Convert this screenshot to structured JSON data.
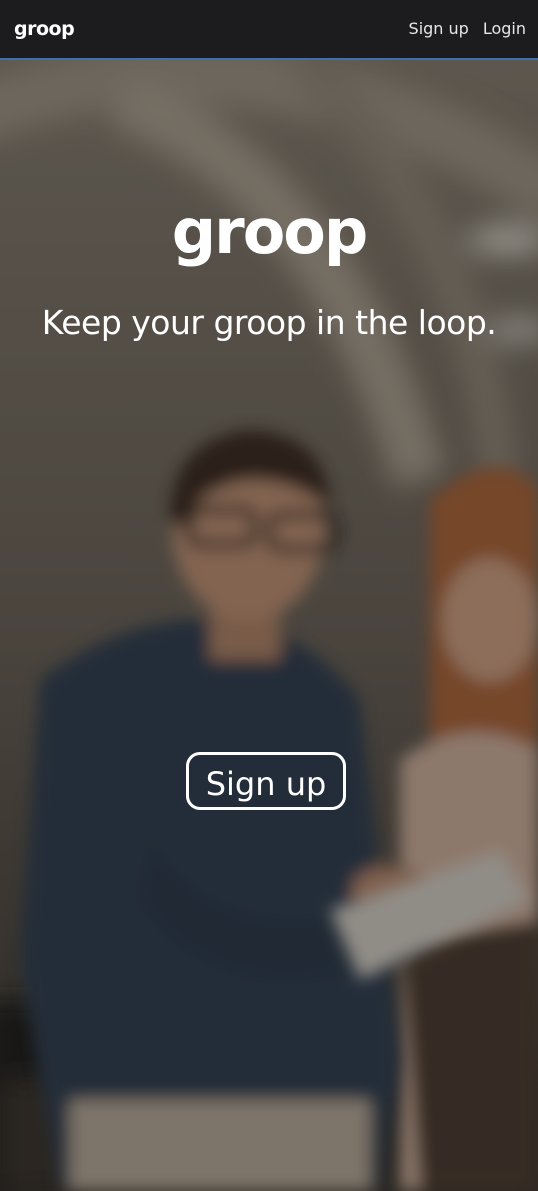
{
  "navbar": {
    "logo": "groop",
    "links": [
      {
        "label": "Sign up"
      },
      {
        "label": "Login"
      }
    ],
    "accent_color": "#3f6fb0"
  },
  "hero": {
    "logo": "groop",
    "tagline": "Keep your groop in the loop.",
    "cta_label": "Sign up",
    "background": "photo-two-people-looking-at-tablet"
  }
}
